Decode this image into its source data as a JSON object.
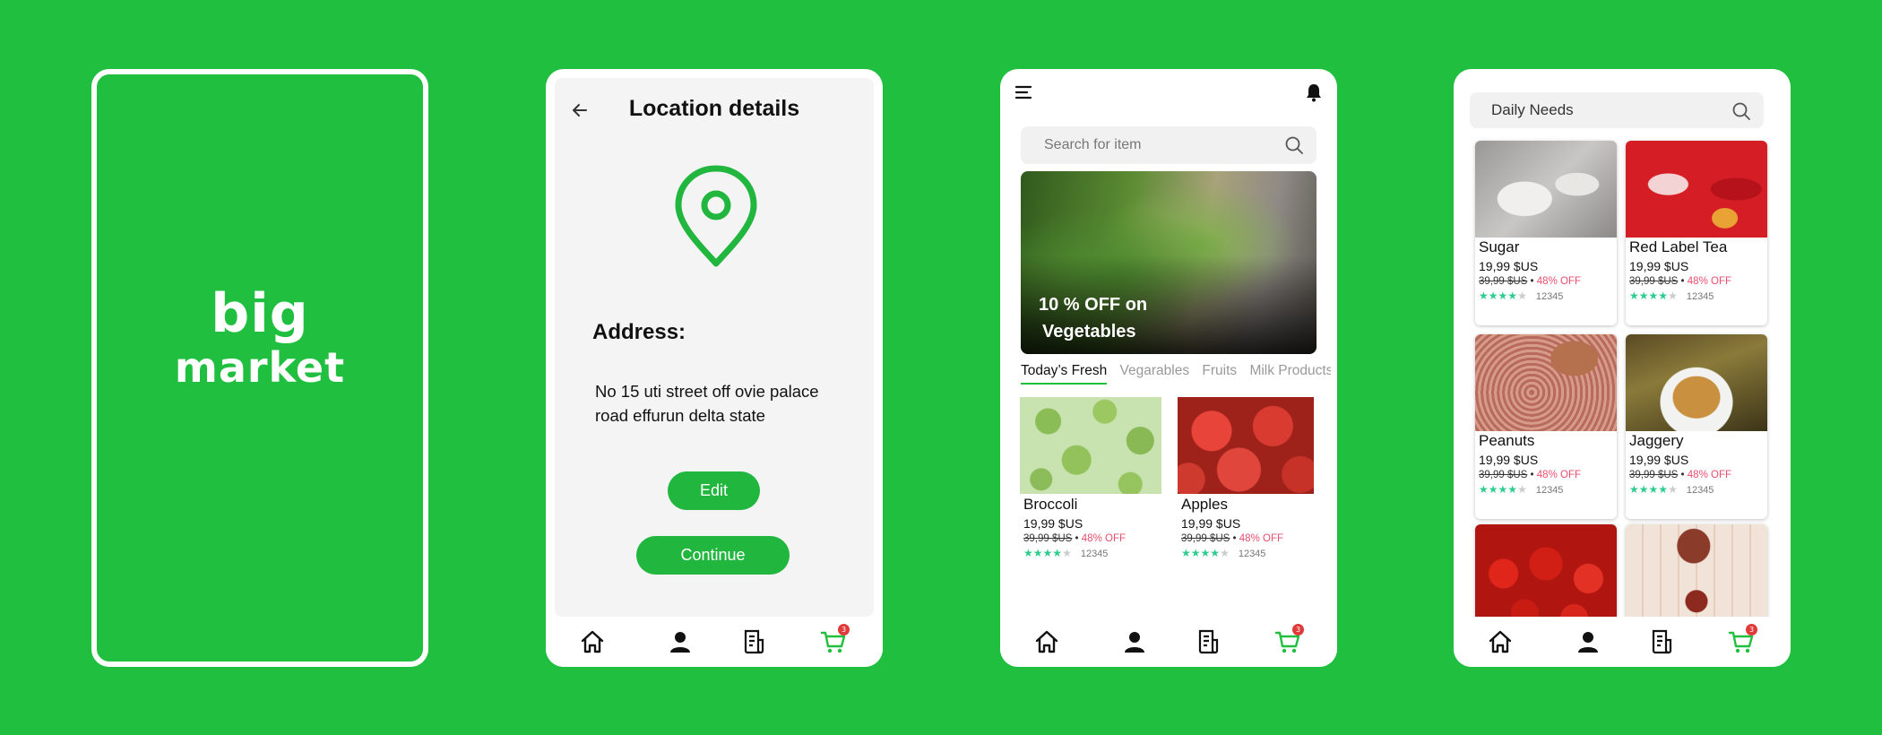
{
  "splash": {
    "logo_line1": "big",
    "logo_line2": "market"
  },
  "location": {
    "title": "Location details",
    "address_label": "Address:",
    "address_text": "No 15 uti street off ovie palace road effurun delta state",
    "edit_label": "Edit",
    "continue_label": "Continue"
  },
  "nav": {
    "cart_badge": "3"
  },
  "home": {
    "search_placeholder": "Search for item",
    "banner_line1": "10 % OFF on",
    "banner_line2": "Vegetables",
    "tabs": [
      "Today’s Fresh",
      "Vegarables",
      "Fruits",
      "Milk Products"
    ],
    "products": [
      {
        "name": "Broccoli",
        "price": "19,99 $US",
        "old_price": "39,99 $US",
        "discount": "48% OFF",
        "rating": 4,
        "reviews": "12345"
      },
      {
        "name": "Apples",
        "price": "19,99 $US",
        "old_price": "39,99 $US",
        "discount": "48% OFF",
        "rating": 4,
        "reviews": "12345"
      }
    ]
  },
  "daily": {
    "search_value": "Daily Needs",
    "products": [
      {
        "name": "Sugar",
        "price": "19,99 $US",
        "old_price": "39,99 $US",
        "discount": "48% OFF",
        "rating": 4,
        "reviews": "12345"
      },
      {
        "name": "Red Label Tea",
        "price": "19,99 $US",
        "old_price": "39,99 $US",
        "discount": "48% OFF",
        "rating": 4,
        "reviews": "12345"
      },
      {
        "name": "Peanuts",
        "price": "19,99 $US",
        "old_price": "39,99 $US",
        "discount": "48% OFF",
        "rating": 4,
        "reviews": "12345"
      },
      {
        "name": "Jaggery",
        "price": "19,99 $US",
        "old_price": "39,99 $US",
        "discount": "48% OFF",
        "rating": 4,
        "reviews": "12345"
      }
    ]
  },
  "colors": {
    "brand_green": "#21bf40",
    "discount_pink": "#e94d6b",
    "star_green": "#2ecc8e",
    "badge_red": "#e03a3a"
  }
}
